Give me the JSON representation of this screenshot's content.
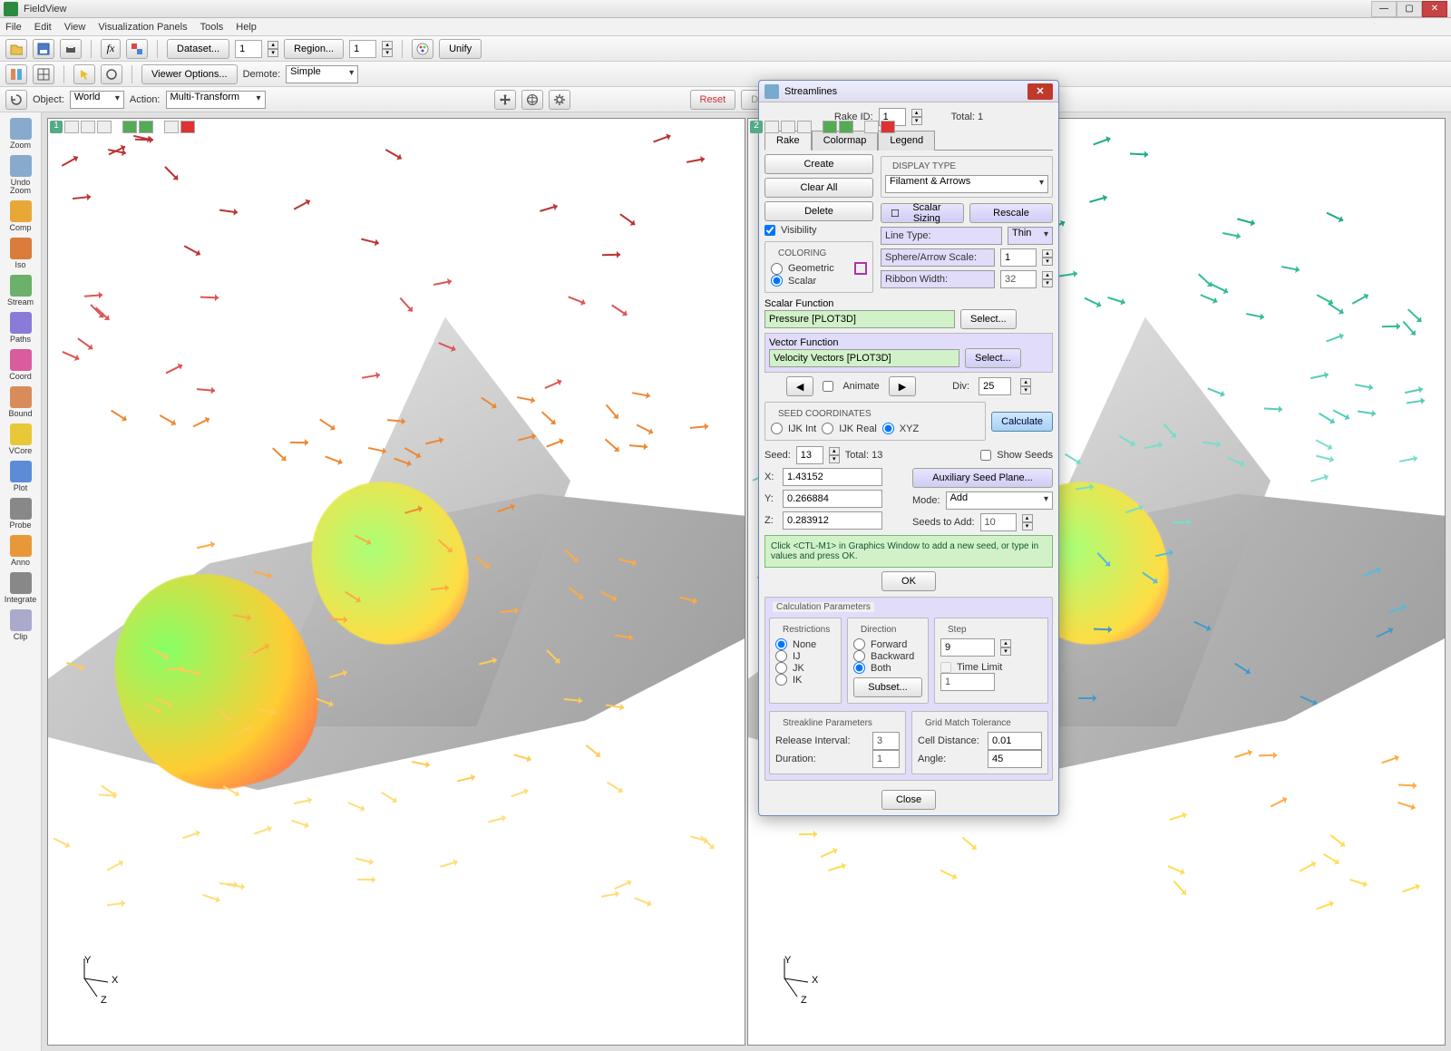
{
  "app": {
    "title": "FieldView"
  },
  "menu": [
    "File",
    "Edit",
    "View",
    "Visualization Panels",
    "Tools",
    "Help"
  ],
  "toolbar1": {
    "dataset_btn": "Dataset...",
    "dataset_val": "1",
    "region_btn": "Region...",
    "region_val": "1",
    "unify_btn": "Unify"
  },
  "toolbar2": {
    "viewer_options": "Viewer Options...",
    "demote_label": "Demote:",
    "demote_val": "Simple"
  },
  "toolbar3": {
    "object_label": "Object:",
    "object_val": "World",
    "action_label": "Action:",
    "action_val": "Multi-Transform",
    "reset_btn": "Reset",
    "detach_btn": "Detach"
  },
  "side_tools": [
    {
      "key": "zoom",
      "label": "Zoom",
      "color": "#8ac"
    },
    {
      "key": "undo-zoom",
      "label": "Undo\nZoom",
      "color": "#8ac"
    },
    {
      "key": "comp",
      "label": "Comp",
      "color": "#e8a838"
    },
    {
      "key": "iso",
      "label": "Iso",
      "color": "#d97c3c"
    },
    {
      "key": "stream",
      "label": "Stream",
      "color": "#6bb06b"
    },
    {
      "key": "paths",
      "label": "Paths",
      "color": "#8a7bd8"
    },
    {
      "key": "coord",
      "label": "Coord",
      "color": "#d85c9e"
    },
    {
      "key": "bound",
      "label": "Bound",
      "color": "#d88c5c"
    },
    {
      "key": "vcore",
      "label": "VCore",
      "color": "#e8c838"
    },
    {
      "key": "plot",
      "label": "Plot",
      "color": "#5c8cd8"
    },
    {
      "key": "probe",
      "label": "Probe",
      "color": "#888"
    },
    {
      "key": "anno",
      "label": "Anno",
      "color": "#e89838"
    },
    {
      "key": "integrate",
      "label": "Integrate",
      "color": "#888"
    },
    {
      "key": "clip",
      "label": "Clip",
      "color": "#aac"
    }
  ],
  "viewports": [
    {
      "num": "1"
    },
    {
      "num": "2"
    }
  ],
  "axis_labels": {
    "x": "X",
    "y": "Y",
    "z": "Z"
  },
  "dialog": {
    "title": "Streamlines",
    "rake_id_label": "Rake ID:",
    "rake_id": "1",
    "total_label": "Total: 1",
    "tabs": [
      "Rake",
      "Colormap",
      "Legend"
    ],
    "active_tab": "Rake",
    "create": "Create",
    "clear": "Clear All",
    "delete": "Delete",
    "visibility": "Visibility",
    "coloring": {
      "legend": "COLORING",
      "geometric": "Geometric",
      "scalar": "Scalar"
    },
    "display_type": {
      "legend": "DISPLAY TYPE",
      "value": "Filament & Arrows"
    },
    "scalar_sizing": "Scalar Sizing",
    "rescale": "Rescale",
    "line_type": {
      "label": "Line Type:",
      "value": "Thin"
    },
    "sphere_scale": {
      "label": "Sphere/Arrow Scale:",
      "value": "1"
    },
    "ribbon_width": {
      "label": "Ribbon Width:",
      "value": "32"
    },
    "scalar_fn": {
      "label": "Scalar Function",
      "value": "Pressure [PLOT3D]",
      "select": "Select..."
    },
    "vector_fn": {
      "label": "Vector Function",
      "value": "Velocity Vectors [PLOT3D]",
      "select": "Select..."
    },
    "animate": "Animate",
    "div_label": "Div:",
    "div": "25",
    "seed_coords": {
      "legend": "SEED COORDINATES",
      "ijkint": "IJK Int",
      "ijkreal": "IJK Real",
      "xyz": "XYZ"
    },
    "calculate": "Calculate",
    "seed_label": "Seed:",
    "seed": "13",
    "seed_total": "Total: 13",
    "show_seeds": "Show Seeds",
    "x_label": "X:",
    "x": "1.43152",
    "y_label": "Y:",
    "y": "0.266884",
    "z_label": "Z:",
    "z": "0.283912",
    "aux_seed": "Auxiliary Seed Plane...",
    "mode_label": "Mode:",
    "mode": "Add",
    "seeds_add_label": "Seeds to Add:",
    "seeds_add": "10",
    "hint": "Click <CTL-M1> in Graphics Window to add a new seed, or type in values and press OK.",
    "ok": "OK",
    "calc_params": "Calculation Parameters",
    "restrictions": {
      "legend": "Restrictions",
      "none": "None",
      "ij": "IJ",
      "jk": "JK",
      "ik": "IK"
    },
    "direction": {
      "legend": "Direction",
      "forward": "Forward",
      "backward": "Backward",
      "both": "Both",
      "subset": "Subset..."
    },
    "step": {
      "legend": "Step",
      "value": "9",
      "time_limit": "Time Limit",
      "time_val": "1"
    },
    "streakline": {
      "legend": "Streakline Parameters",
      "release": "Release Interval:",
      "release_val": "3",
      "duration": "Duration:",
      "duration_val": "1"
    },
    "grid_match": {
      "legend": "Grid Match Tolerance",
      "cell": "Cell Distance:",
      "cell_val": "0.01",
      "angle": "Angle:",
      "angle_val": "45"
    },
    "close": "Close"
  }
}
